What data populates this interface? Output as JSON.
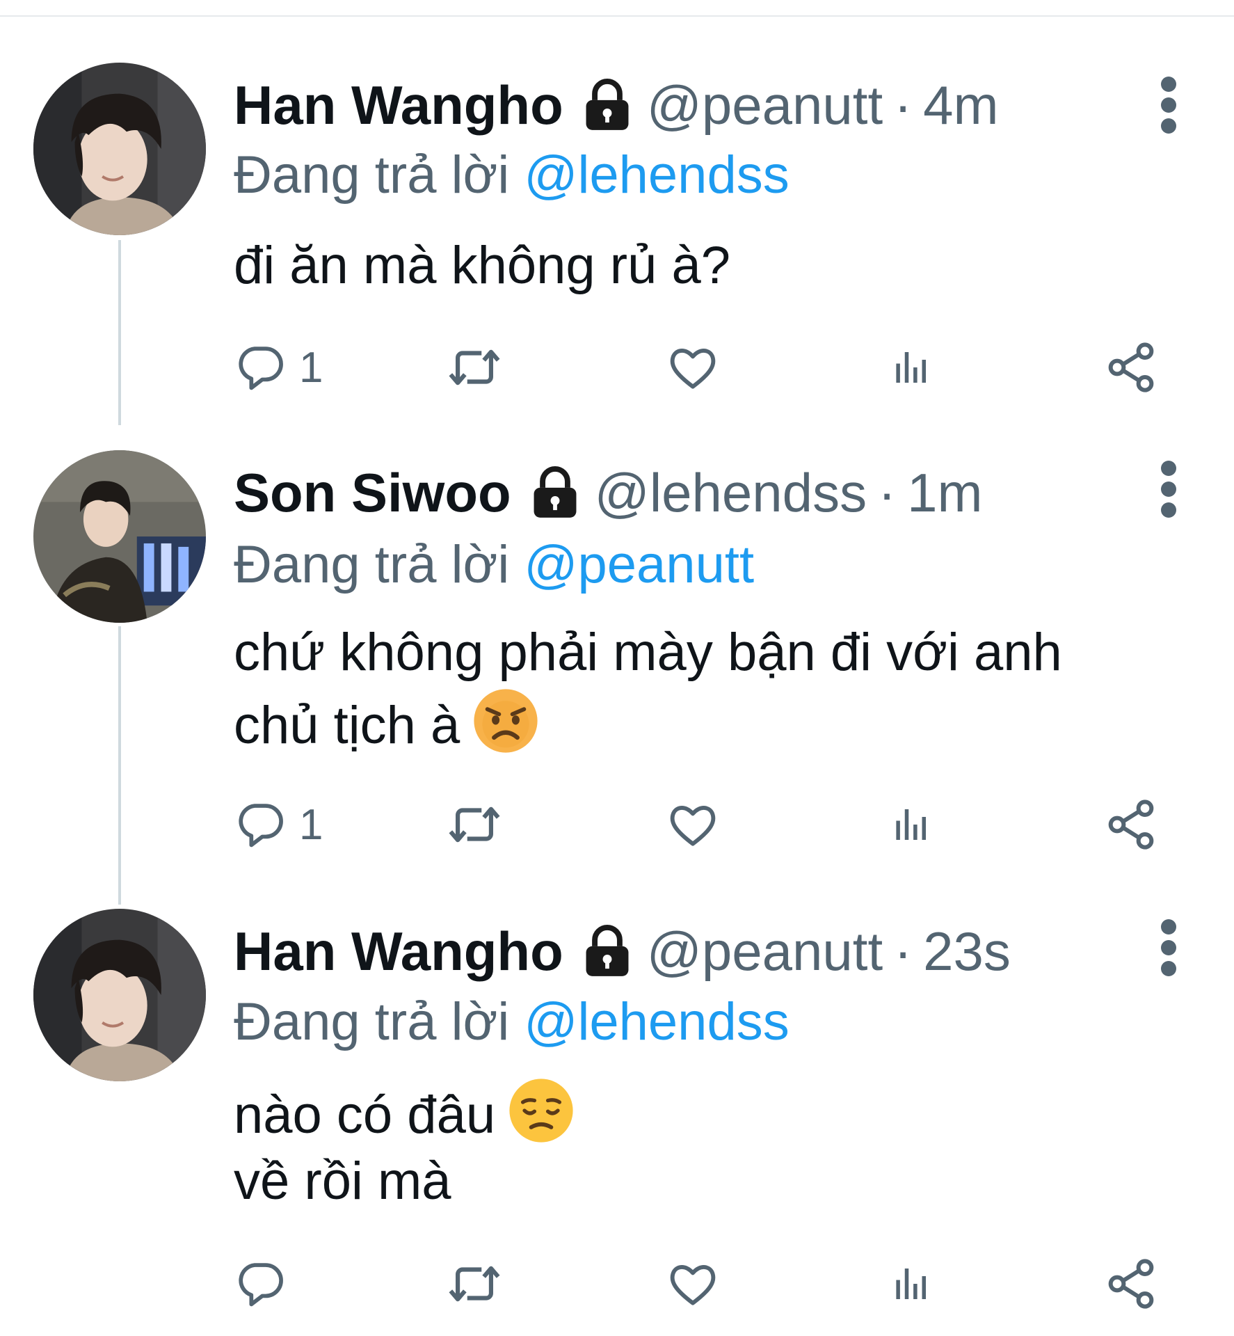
{
  "reply_prefix": "Đang trả lời",
  "colors": {
    "link": "#1d9bf0",
    "secondary_text": "#536471",
    "primary_text": "#0f1419",
    "thread_line": "#cfd9de"
  },
  "tweets": [
    {
      "display_name": "Han Wangho",
      "handle": "@peanutt",
      "separator": "·",
      "time": "4m",
      "reply_to": "@lehendss",
      "body": [
        "đi ăn mà không rủ à?"
      ],
      "reply_count": "1",
      "protected_icon": "lock-icon"
    },
    {
      "display_name": "Son Siwoo",
      "handle": "@lehendss",
      "separator": "·",
      "time": "1m",
      "reply_to": "@peanutt",
      "body": [
        "chứ không phải mày bận đi với anh",
        "chủ tịch à"
      ],
      "emoji": "pouting-face-emoji",
      "reply_count": "1",
      "protected_icon": "lock-icon"
    },
    {
      "display_name": "Han Wangho",
      "handle": "@peanutt",
      "separator": "·",
      "time": "23s",
      "reply_to": "@lehendss",
      "body": [
        "nào có đâu",
        "về rồi mà"
      ],
      "emoji": "disappointed-face-emoji",
      "reply_count": "",
      "protected_icon": "lock-icon"
    }
  ],
  "action_icons": [
    "reply-icon",
    "retweet-icon",
    "like-icon",
    "analytics-icon",
    "share-icon"
  ]
}
